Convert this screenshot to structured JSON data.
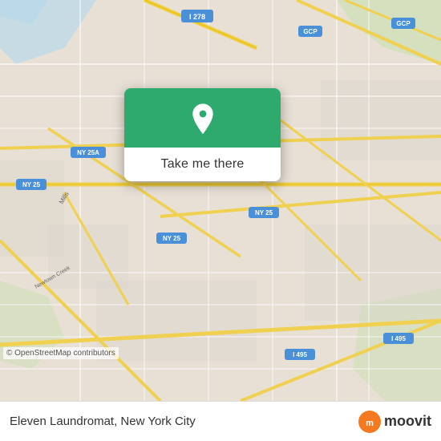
{
  "map": {
    "background_color": "#e4ddd4",
    "copyright": "© OpenStreetMap contributors"
  },
  "popup": {
    "button_label": "Take me there",
    "pin_color": "#ffffff"
  },
  "bottom_bar": {
    "location_name": "Eleven Laundromat, New York City",
    "moovit_text": "moovit"
  },
  "roads": {
    "i278_label": "I 278",
    "i495_label": "I 495",
    "ny25_label": "NY 25",
    "ny25a_label": "NY 25A",
    "gcp_label": "GCP"
  }
}
